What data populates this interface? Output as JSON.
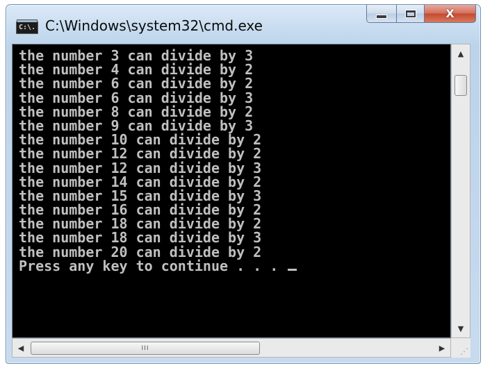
{
  "window": {
    "title": "C:\\Windows\\system32\\cmd.exe",
    "icon_label": "C:\\."
  },
  "console": {
    "lines": [
      "the number 3 can divide by 3",
      "the number 4 can divide by 2",
      "the number 6 can divide by 2",
      "the number 6 can divide by 3",
      "the number 8 can divide by 2",
      "the number 9 can divide by 3",
      "the number 10 can divide by 2",
      "the number 12 can divide by 2",
      "the number 12 can divide by 3",
      "the number 14 can divide by 2",
      "the number 15 can divide by 3",
      "the number 16 can divide by 2",
      "the number 18 can divide by 2",
      "the number 18 can divide by 3",
      "the number 20 can divide by 2"
    ],
    "prompt": "Press any key to continue . . . ",
    "text_color": "#c0c0c0",
    "background_color": "#000000"
  },
  "caption_buttons": {
    "minimize_icon": "minimize-icon",
    "maximize_icon": "maximize-icon",
    "close_glyph": "X"
  },
  "scrollbars": {
    "up_arrow": "▲",
    "down_arrow": "▼",
    "left_arrow": "◀",
    "right_arrow": "▶",
    "h_thumb_grip": "III",
    "size_grip": "⋰"
  }
}
